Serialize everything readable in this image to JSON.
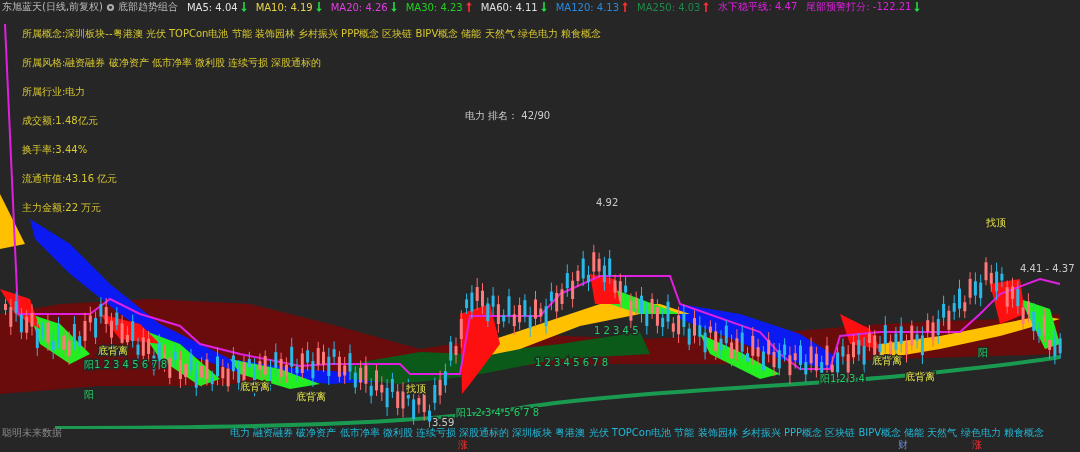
{
  "header": {
    "title": "东旭蓝天(日线,前复权)",
    "indicator": "底部趋势组合",
    "items": [
      {
        "text": "MA5: 4.04",
        "color": "#e0e0e0",
        "rising": false
      },
      {
        "text": "MA10: 4.19",
        "color": "#e8d44a",
        "rising": false
      },
      {
        "text": "MA20: 4.26",
        "color": "#e040e0",
        "rising": false
      },
      {
        "text": "MA30: 4.23",
        "color": "#22d022",
        "rising": true
      },
      {
        "text": "MA60: 4.11",
        "color": "#e0e0e0",
        "rising": false
      },
      {
        "text": "MA120: 4.13",
        "color": "#2a8ae0",
        "rising": true
      },
      {
        "text": "MA250: 4.03",
        "color": "#1e8a4a",
        "rising": true
      },
      {
        "text": "水下稳平线: 4.47",
        "color": "#e020e0"
      },
      {
        "text": "尾部预警打分: -122.21",
        "color": "#e020e0",
        "rising": false
      }
    ]
  },
  "info_lines": [
    "所属概念:深圳板块--粤港澳 光伏 TOPCon电池 节能 装饰园林 乡村振兴 PPP概念 区块链 BIPV概念 储能 天然气 绿色电力 粮食概念",
    "所属风格:融资融券 破净资产 低市净率 微利股 连续亏损 深股通标的",
    "所属行业:电力",
    "成交额:1.48亿元",
    "换手率:3.44%",
    "流通市值:43.16 亿元",
    "主力金额:22 万元"
  ],
  "rank": "电力 排名： 42/90",
  "chart_labels": [
    {
      "kind": "price",
      "text": "4.92"
    },
    {
      "kind": "price",
      "text": "3.59"
    },
    {
      "kind": "price",
      "text": "4.41 - 4.37"
    },
    {
      "kind": "signal",
      "text": "底背离"
    },
    {
      "kind": "signal",
      "text": "底背离"
    },
    {
      "kind": "signal",
      "text": "底背离"
    },
    {
      "kind": "signal",
      "text": "底背离"
    },
    {
      "kind": "signal",
      "text": "底背离"
    },
    {
      "kind": "signal",
      "text": "找顶"
    },
    {
      "kind": "signal",
      "text": "找顶"
    },
    {
      "kind": "count",
      "text": "阳1 2 3 4 5 6 7 8"
    },
    {
      "kind": "count",
      "text": "1 2 3 4 5 6 7 8"
    },
    {
      "kind": "count",
      "text": "阳1 2 3 4 5 6 7 8"
    },
    {
      "kind": "count",
      "text": "1 2 3 4 5"
    },
    {
      "kind": "count",
      "text": "阳1 2 3 4"
    },
    {
      "kind": "count",
      "text": "阳"
    },
    {
      "kind": "count",
      "text": "阳"
    }
  ],
  "concepts": "电力 融资融券 破净资产 低市净率 微利股 连续亏损 深股通标的 深圳板块 粤港澳 光伏 TOPCon电池 节能 装饰园林 乡村振兴 PPP概念 区块链 BIPV概念 储能 天然气 绿色电力 粮食概念",
  "footer_note": "聪明未来数据",
  "date_marks": [
    "涨",
    "财",
    "涨"
  ]
}
